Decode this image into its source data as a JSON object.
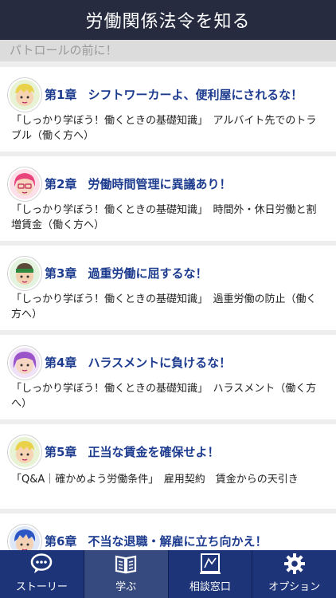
{
  "header": {
    "title": "労働関係法令を知る"
  },
  "section": {
    "label": "パトロールの前に！"
  },
  "chapters": [
    {
      "num": "第1章",
      "title": "シフトワーカーよ、便利屋にされるな！",
      "desc": "「しっかり学ぼう！働くときの基礎知識」　アルバイト先でのトラブル（働く方へ）",
      "avatar": "avatar-blond-boy-icon"
    },
    {
      "num": "第2章",
      "title": "労働時間管理に異議あり！",
      "desc": "「しっかり学ぼう！働くときの基礎知識」　時間外・休日労働と割増賃金（働く方へ）",
      "avatar": "avatar-pink-hair-glasses-icon"
    },
    {
      "num": "第3章",
      "title": "過重労働に屈するな！",
      "desc": "「しっかり学ぼう！働くときの基礎知識」　過重労働の防止（働く方へ）",
      "avatar": "avatar-headband-boy-icon"
    },
    {
      "num": "第4章",
      "title": "ハラスメントに負けるな！",
      "desc": "「しっかり学ぼう！働くときの基礎知識」　ハラスメント（働く方へ）",
      "avatar": "avatar-purple-hair-girl-icon"
    },
    {
      "num": "第5章",
      "title": "正当な賃金を確保せよ！",
      "desc": "「Q&A｜確かめよう労働条件」　雇用契約　賃金からの天引き",
      "avatar": "avatar-blond-boy-icon"
    },
    {
      "num": "第6章",
      "title": "不当な退職・解雇に立ち向かえ！",
      "desc": "",
      "avatar": "avatar-blue-hair-boy-icon"
    }
  ],
  "tabs": [
    {
      "label": "ストーリー",
      "icon": "chat-bubble-icon",
      "active": false
    },
    {
      "label": "学ぶ",
      "icon": "book-icon",
      "active": true
    },
    {
      "label": "相談窓口",
      "icon": "consultation-window-icon",
      "active": false
    },
    {
      "label": "オプション",
      "icon": "gear-icon",
      "active": false
    }
  ]
}
